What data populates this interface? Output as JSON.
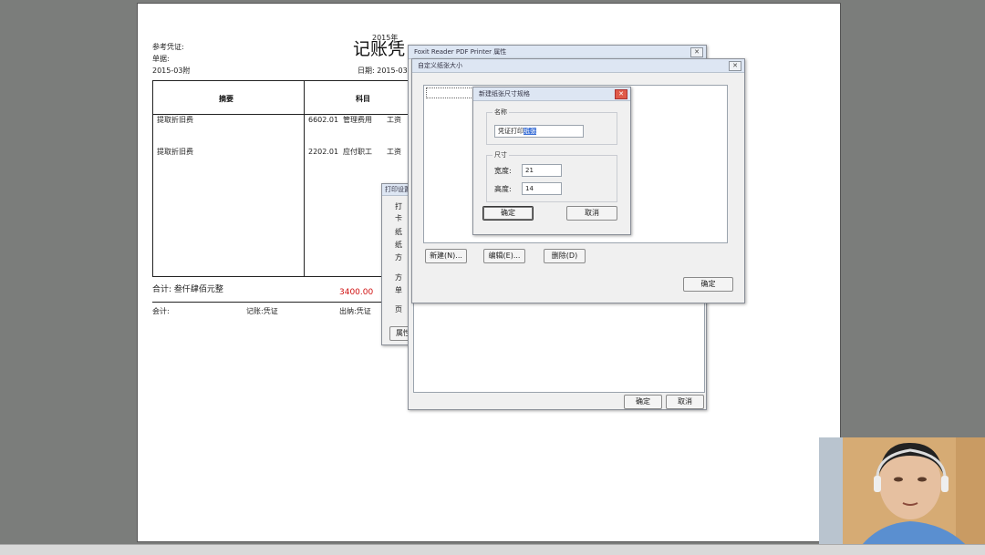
{
  "voucher": {
    "header_top": "2015年",
    "left_line1": "参考凭证:",
    "left_line2": "单据:",
    "left_line3": "2015-03附",
    "title": "记账凭",
    "date_line": "日期: 2015-03",
    "col_summary": "摘要",
    "col_account": "科目",
    "row1_summary": "提取折旧费",
    "row1_code": "6602.01",
    "row1_account": "管理费用",
    "row1_tail": "工资",
    "row2_summary": "提取折旧费",
    "row2_code": "2202.01",
    "row2_account": "应付职工",
    "row2_tail": "工资",
    "total_label": "合计: 叁仟肆佰元整",
    "total_red": "3400.00",
    "footer_1": "会计:",
    "footer_2": "记账:凭证",
    "footer_3": "出纳:凭证"
  },
  "back_dialog": {
    "title": "Foxit Reader PDF Printer 属性",
    "ok": "确定",
    "cancel": "取消"
  },
  "partial_dialog": {
    "title": "打印设置",
    "lines": [
      "打",
      "卡",
      "纸",
      "纸",
      "方",
      "方",
      "单",
      "页"
    ],
    "bottom": "属性"
  },
  "paper_dialog": {
    "title": "自定义纸张大小",
    "list_item": "",
    "btn_new": "新建(N)...",
    "btn_edit": "编辑(E)...",
    "btn_delete": "删除(D)",
    "btn_ok": "确定"
  },
  "name_dialog": {
    "title": "新建纸张尺寸规格",
    "name_group": "名称",
    "name_value_prefix": "凭证打印",
    "name_value_selected": "纸张",
    "size_group": "尺寸",
    "width_label": "宽度:",
    "width_value": "21",
    "height_label": "高度:",
    "height_value": "14",
    "ok": "确定",
    "cancel": "取消"
  },
  "colors": {
    "accent": "#3a6fd6",
    "red_amount": "#d01010",
    "titlebar": "#dde6f3"
  }
}
